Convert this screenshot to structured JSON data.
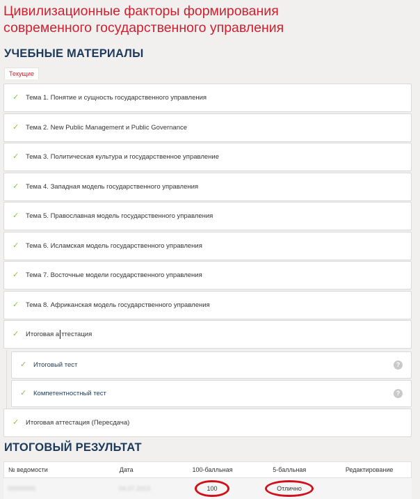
{
  "course": {
    "title_line1": "Цивилизационные факторы формирования",
    "title_line2": "современного государственного управления"
  },
  "materials": {
    "heading": "УЧЕБНЫЕ МАТЕРИАЛЫ",
    "tab": "Текущие",
    "topics": [
      "Тема 1. Понятие и сущность государственного управления",
      "Тема 2. New Public Management и Public Governance",
      "Тема 3. Политическая культура и государственное управление",
      "Тема 4. Западная модель государственного управления",
      "Тема 5. Православная модель государственного управления",
      "Тема 6. Исламская модель государственного управления",
      "Тема 7. Восточные модели государственного управления",
      "Тема 8. Африканская модель государственного управления"
    ],
    "final": {
      "label_a": "Итоговая а",
      "label_b": "ттестация",
      "subitems": [
        "Итоговый тест",
        "Компетентностный тест"
      ]
    },
    "retake": "Итоговая аттестация (Пересдача)",
    "help_glyph": "?"
  },
  "results": {
    "heading": "ИТОГОВЫЙ РЕЗУЛЬТАТ",
    "columns": [
      "№ ведомости",
      "Дата",
      "100-балльная",
      "5-балльная",
      "Редактирование"
    ],
    "row": {
      "number": "00000000",
      "date": "04.07.2023",
      "score100": "100",
      "score5": "Отлично"
    }
  },
  "colors": {
    "accent_red": "#cf2030",
    "heading_navy": "#1d3a5c",
    "check_green": "#8ac24a",
    "highlight_oval": "#d0101a"
  }
}
